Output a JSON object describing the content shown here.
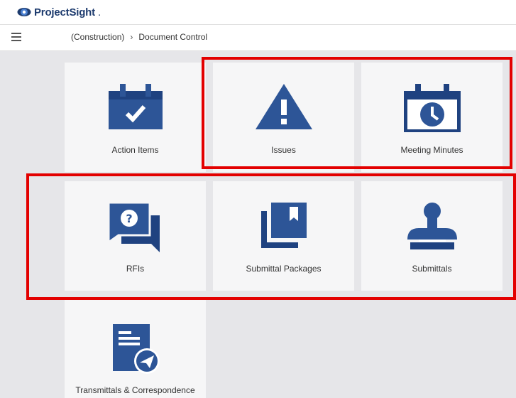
{
  "app": {
    "logo_text": "ProjectSight",
    "logo_suffix": "."
  },
  "nav": {
    "breadcrumb": [
      "(Construction)",
      "Document Control"
    ],
    "separator": "›"
  },
  "tiles": [
    {
      "label": "Action Items",
      "icon": "calendar-check-icon"
    },
    {
      "label": "Issues",
      "icon": "warning-triangle-icon"
    },
    {
      "label": "Meeting Minutes",
      "icon": "calendar-clock-icon"
    },
    {
      "label": "RFIs",
      "icon": "question-chat-icon"
    },
    {
      "label": "Submittal Packages",
      "icon": "bookmark-stack-icon"
    },
    {
      "label": "Submittals",
      "icon": "stamp-icon"
    },
    {
      "label": "Transmittals & Correspondence",
      "icon": "document-send-icon"
    }
  ],
  "colors": {
    "icon_blue": "#2d5597",
    "highlight_red": "#e30000",
    "brand_navy": "#1d3b6e"
  }
}
